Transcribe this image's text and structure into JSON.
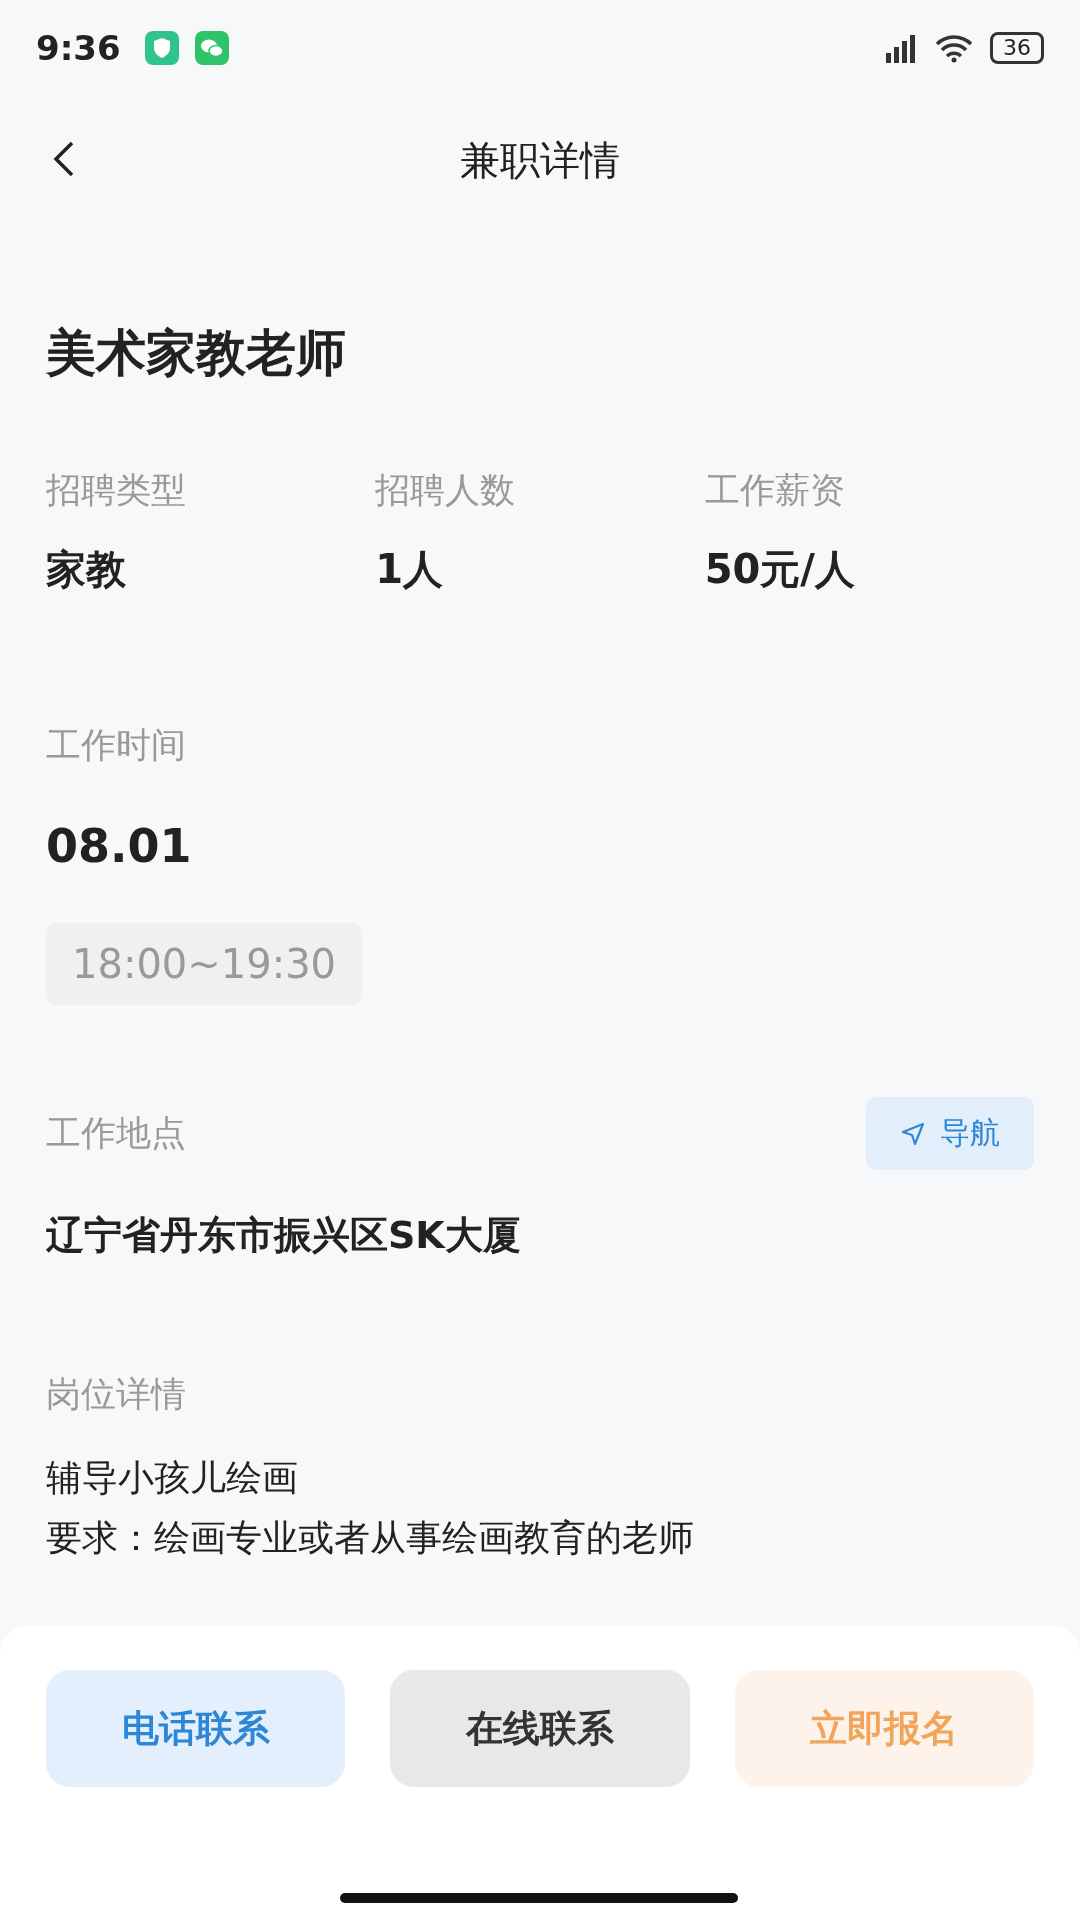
{
  "status_bar": {
    "time": "9:36",
    "battery": "36"
  },
  "header": {
    "title": "兼职详情"
  },
  "job": {
    "title": "美术家教老师",
    "facts": [
      {
        "label": "招聘类型",
        "value": "家教"
      },
      {
        "label": "招聘人数",
        "value": "1人"
      },
      {
        "label": "工作薪资",
        "value": "50元/人"
      }
    ],
    "work_time": {
      "label": "工作时间",
      "date": "08.01",
      "slots": [
        "18:00~19:30"
      ]
    },
    "location": {
      "label": "工作地点",
      "address": "辽宁省丹东市振兴区SK大厦",
      "nav_button": "导航"
    },
    "details": {
      "label": "岗位详情",
      "lines": [
        "辅导小孩儿绘画",
        "要求：绘画专业或者从事绘画教育的老师"
      ]
    }
  },
  "actions": [
    {
      "label": "电话联系",
      "kind": "phone"
    },
    {
      "label": "在线联系",
      "kind": "chat"
    },
    {
      "label": "立即报名",
      "kind": "apply"
    }
  ]
}
